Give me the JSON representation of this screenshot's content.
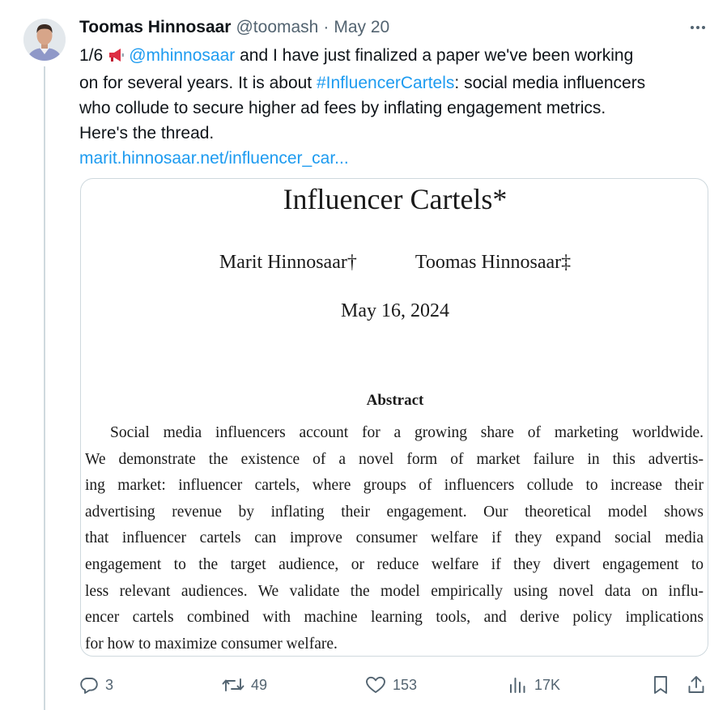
{
  "tweet": {
    "author": {
      "display_name": "Toomas Hinnosaar",
      "handle": "@toomash",
      "separator": "·",
      "date": "May 20"
    },
    "text": {
      "counter": "1/6",
      "mention": "@mhinnosaar",
      "line1_rest": "and I have just finalized a paper we've been working",
      "line2": "on for several years. It is about",
      "hashtag": "#InfluencerCartels",
      "line3_rest": ": social media influencers",
      "line4": "who collude to secure higher ad fees by inflating engagement metrics.",
      "line5": "Here's the thread.",
      "url": "marit.hinnosaar.net/influencer_car..."
    },
    "media": {
      "paper_title": "Influencer Cartels*",
      "author_1": "Marit Hinnosaar†",
      "author_2": "Toomas Hinnosaar‡",
      "paper_date": "May 16, 2024",
      "abstract_heading": "Abstract",
      "abstract_lines": [
        "Social media influencers account for a growing share of marketing worldwide.",
        "We demonstrate the existence of a novel form of market failure in this advertis-",
        "ing market: influencer cartels, where groups of influencers collude to increase their",
        "advertising revenue by inflating their engagement. Our theoretical model shows",
        "that influencer cartels can improve consumer welfare if they expand social media",
        "engagement to the target audience, or reduce welfare if they divert engagement to",
        "less relevant audiences. We validate the model empirically using novel data on influ-",
        "encer cartels combined with machine learning tools, and derive policy implications",
        "for how to maximize consumer welfare."
      ]
    },
    "actions": {
      "replies": "3",
      "reposts": "49",
      "likes": "153",
      "views": "17K"
    }
  },
  "icons": {
    "megaphone": "megaphone-emoji",
    "more": "more-horizontal-icon",
    "reply": "reply-icon",
    "repost": "repost-icon",
    "like": "heart-icon",
    "views": "views-chart-icon",
    "bookmark": "bookmark-icon",
    "share": "share-icon"
  },
  "colors": {
    "link": "#1d9bf0",
    "secondary_text": "#536471",
    "primary_text": "#0f1419",
    "border": "#cfd9de"
  }
}
